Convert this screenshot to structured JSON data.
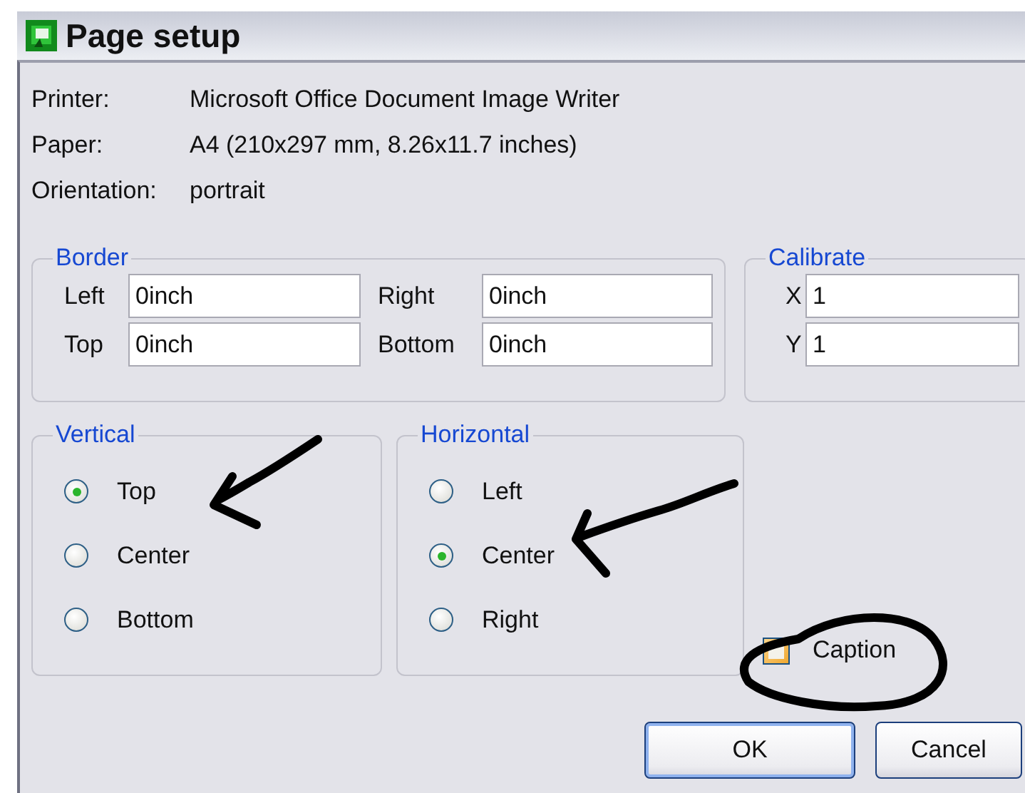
{
  "window": {
    "title": "Page setup"
  },
  "info": [
    {
      "label": "Printer:",
      "value": "Microsoft Office Document Image Writer"
    },
    {
      "label": "Paper:",
      "value": "A4 (210x297 mm, 8.26x11.7 inches)"
    },
    {
      "label": "Orientation:",
      "value": "portrait"
    }
  ],
  "border": {
    "title": "Border",
    "fields": [
      {
        "label": "Left",
        "value": "0inch"
      },
      {
        "label": "Right",
        "value": "0inch"
      },
      {
        "label": "Top",
        "value": "0inch"
      },
      {
        "label": "Bottom",
        "value": "0inch"
      }
    ]
  },
  "calibrate": {
    "title": "Calibrate",
    "fields": [
      {
        "label": "X",
        "value": "1"
      },
      {
        "label": "Y",
        "value": "1"
      }
    ]
  },
  "vertical": {
    "title": "Vertical",
    "options": [
      {
        "label": "Top",
        "selected": true
      },
      {
        "label": "Center",
        "selected": false
      },
      {
        "label": "Bottom",
        "selected": false
      }
    ]
  },
  "horizontal": {
    "title": "Horizontal",
    "options": [
      {
        "label": "Left",
        "selected": false
      },
      {
        "label": "Center",
        "selected": true
      },
      {
        "label": "Right",
        "selected": false
      }
    ]
  },
  "caption": {
    "label": "Caption",
    "checked": false
  },
  "buttons": [
    {
      "label": "OK",
      "focused": true
    },
    {
      "label": "Cancel",
      "focused": false
    }
  ],
  "annotations": [
    {
      "kind": "arrow"
    },
    {
      "kind": "arrow"
    },
    {
      "kind": "circle"
    }
  ]
}
